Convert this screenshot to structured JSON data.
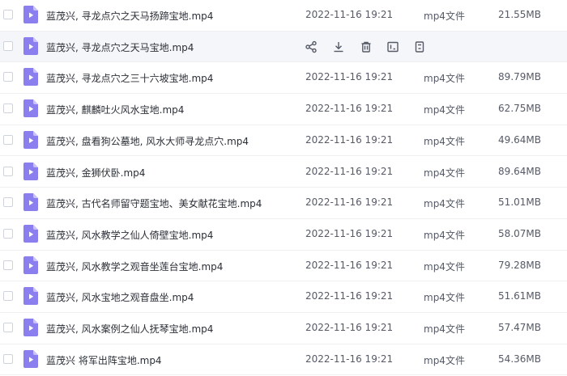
{
  "files": [
    {
      "name": "蓝茂兴, 寻龙点穴之天马扬蹄宝地.mp4",
      "date": "2022-11-16 19:21",
      "type": "mp4文件",
      "size": "21.55MB"
    },
    {
      "name": "蓝茂兴, 寻龙点穴之天马宝地.mp4",
      "date": "",
      "type": "",
      "size": "",
      "hover": true
    },
    {
      "name": "蓝茂兴, 寻龙点穴之三十六坡宝地.mp4",
      "date": "2022-11-16 19:21",
      "type": "mp4文件",
      "size": "89.79MB"
    },
    {
      "name": "蓝茂兴, 麒麟吐火风水宝地.mp4",
      "date": "2022-11-16 19:21",
      "type": "mp4文件",
      "size": "62.75MB"
    },
    {
      "name": "蓝茂兴, 盘看狗公墓地, 风水大师寻龙点穴.mp4",
      "date": "2022-11-16 19:21",
      "type": "mp4文件",
      "size": "49.64MB"
    },
    {
      "name": "蓝茂兴, 金狮伏卧.mp4",
      "date": "2022-11-16 19:21",
      "type": "mp4文件",
      "size": "89.64MB"
    },
    {
      "name": "蓝茂兴, 古代名师留守题宝地、美女献花宝地.mp4",
      "date": "2022-11-16 19:21",
      "type": "mp4文件",
      "size": "51.01MB"
    },
    {
      "name": "蓝茂兴, 风水教学之仙人倚壁宝地.mp4",
      "date": "2022-11-16 19:21",
      "type": "mp4文件",
      "size": "58.07MB"
    },
    {
      "name": "蓝茂兴, 风水教学之观音坐莲台宝地.mp4",
      "date": "2022-11-16 19:21",
      "type": "mp4文件",
      "size": "79.28MB"
    },
    {
      "name": "蓝茂兴, 风水宝地之观音盘坐.mp4",
      "date": "2022-11-16 19:21",
      "type": "mp4文件",
      "size": "51.61MB"
    },
    {
      "name": "蓝茂兴, 风水案例之仙人抚琴宝地.mp4",
      "date": "2022-11-16 19:21",
      "type": "mp4文件",
      "size": "57.47MB"
    },
    {
      "name": "蓝茂兴 将军出阵宝地.mp4",
      "date": "2022-11-16 19:21",
      "type": "mp4文件",
      "size": "54.36MB"
    }
  ],
  "row_actions": [
    {
      "name": "share-icon"
    },
    {
      "name": "download-icon"
    },
    {
      "name": "delete-icon"
    },
    {
      "name": "rename-icon"
    },
    {
      "name": "more-icon"
    }
  ],
  "colors": {
    "file_icon": "#8b7ff0",
    "hover_row": "#f5f6f9",
    "action_icon": "#555a66"
  }
}
